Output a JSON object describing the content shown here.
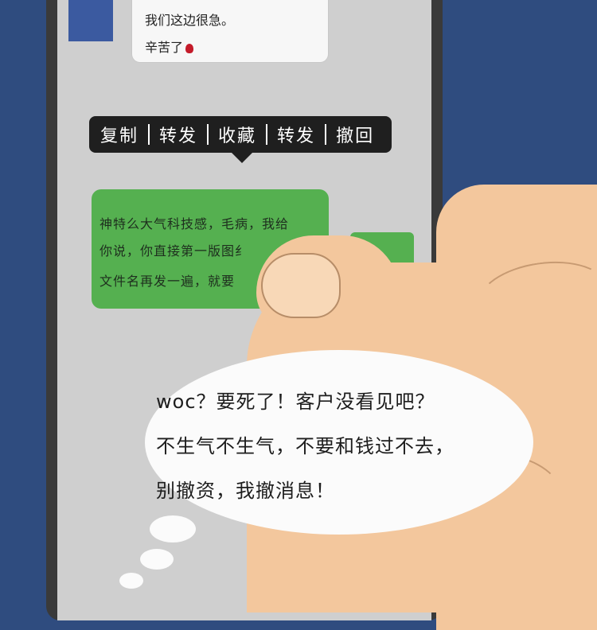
{
  "top_chat": {
    "line1": "我们这边很急。",
    "line2": "辛苦了"
  },
  "context_menu": {
    "items": [
      "复制",
      "转发",
      "收藏",
      "转发",
      "撤回"
    ]
  },
  "green_message": {
    "line1": "神特么大气科技感，毛病，我给",
    "line2": "你说，你直接第一版图纟",
    "line3": "文件名再发一遍，就要"
  },
  "thought": {
    "line1": "woc？要死了！客户没看见吧？",
    "line2": "不生气不生气，不要和钱过不去，",
    "line3": "别撤资，我撤消息！"
  },
  "colors": {
    "background": "#2f4c7f",
    "bubble_green": "#55b050",
    "menu_bg": "#1f1f1f",
    "skin": "#f3c79d"
  },
  "icons": {
    "rose": "rose-emoji-icon"
  }
}
